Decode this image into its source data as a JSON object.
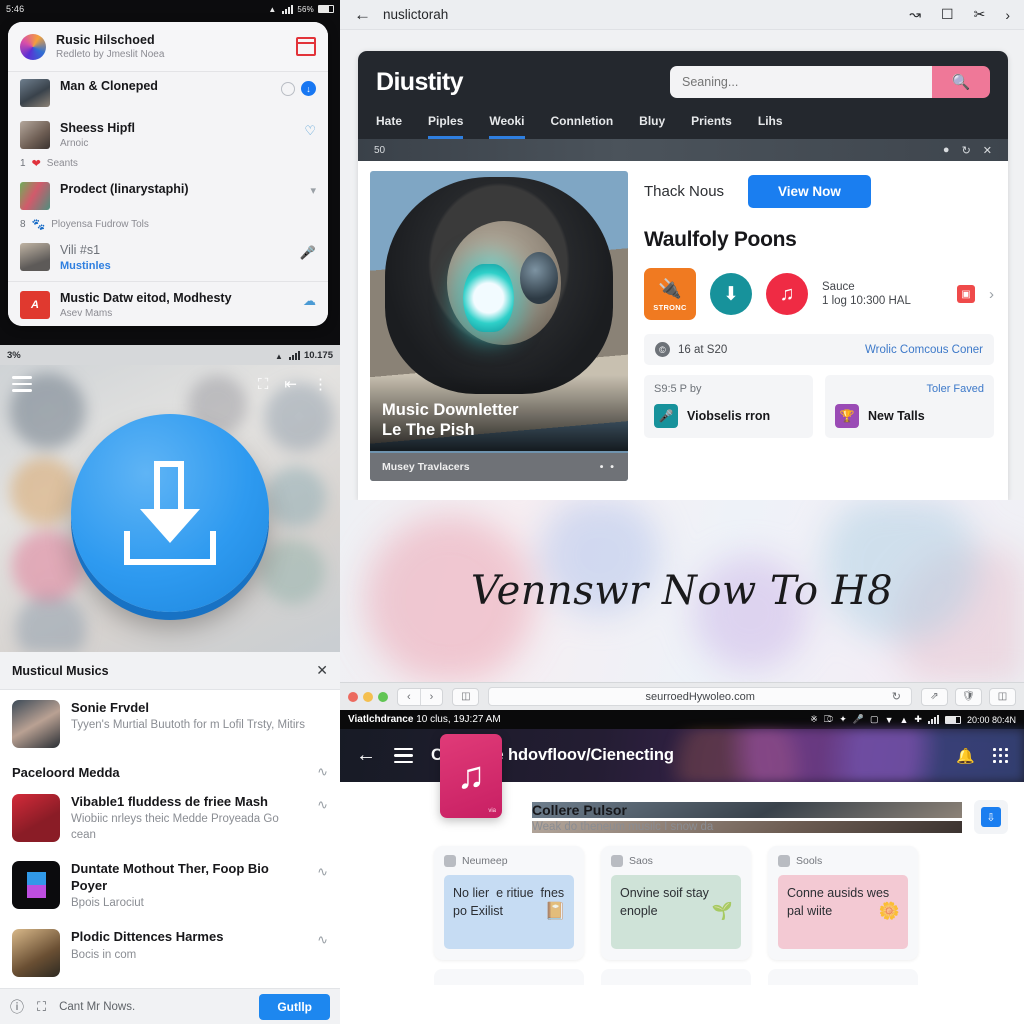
{
  "panel_a": {
    "status": {
      "time": "5:46",
      "battery": "56%"
    },
    "card": {
      "title": "Rusic Hilschoed",
      "subtitle": "Redleto by Jmeslit Noea",
      "action_icon": "inbox-icon"
    },
    "rows": [
      {
        "title": "Man & Cloneped",
        "sub": "",
        "tail": [
          "circle-icon",
          "download-badge"
        ]
      },
      {
        "title": "Sheess Hipfl",
        "sub": "Arnoic",
        "tail": [
          "heart-outline-icon"
        ]
      },
      {
        "meta_count": "1",
        "meta_icon": "heart-icon",
        "meta_text": "Seants"
      },
      {
        "title": "Prodect (linarystaphi)",
        "sub": "",
        "tail": [
          "chevron-down-icon"
        ]
      },
      {
        "meta_count": "8",
        "meta_icon": "paw-icon",
        "meta_text": "Ployensa Fudrow Tols"
      },
      {
        "title": "Vili #s1",
        "sub": "Mustinles",
        "tail": [
          "microphone-icon"
        ]
      },
      {
        "title": "Mustic Datw eitod, Modhesty",
        "sub": "Asev Mams",
        "tail": [
          "cloud-icon"
        ]
      }
    ]
  },
  "panel_b": {
    "status": {
      "left": "3%",
      "right": "10.175"
    },
    "topbar_icons": [
      "menu-icon",
      "camera-icon",
      "share-icon",
      "more-vertical-icon"
    ],
    "download_button": "download-icon",
    "sheet": {
      "title": "Musticul Musics",
      "close": "close-icon"
    },
    "items": [
      {
        "title": "Sonie Frvdel",
        "sub": "Tyyen's Murtial Buutoth for m Lofil Trsty, Mitirs"
      }
    ],
    "section": {
      "label": "Paceloord Medda",
      "chevron": "chevron-icon"
    },
    "media": [
      {
        "title": "Vibable1 fluddess de friee Mash",
        "sub": "Wiobiic nrleys theic Medde Proyeada Go cean"
      },
      {
        "title": "Duntate Mothout Ther, Foop Bio Poyer",
        "sub": "Bpois Larociut"
      },
      {
        "title": "Plodic Dittences Harmes",
        "sub": "Bocis in com"
      }
    ],
    "bottom": {
      "icons": [
        "info-icon",
        "camera-icon"
      ],
      "label": "Cant Mr Nows.",
      "button": "Gutllp"
    }
  },
  "panel_c": {
    "toolbar": {
      "back": "back-arrow-icon",
      "url": "nuslictorah",
      "actions": [
        "undo-icon",
        "save-icon",
        "cut-icon",
        "forward-icon"
      ]
    },
    "site": {
      "logo": "Diustity",
      "search": {
        "placeholder": "Seaning...",
        "button_icon": "search-icon"
      },
      "nav": [
        "Hate",
        "Piples",
        "Weoki",
        "Connletion",
        "Bluy",
        "Prients",
        "Lihs"
      ],
      "nav_active": [
        1,
        2
      ],
      "subbar": {
        "left": "50",
        "icons": [
          "location-icon",
          "refresh-icon",
          "close-icon"
        ]
      },
      "hero": {
        "caption_line1": "Music Downletter",
        "caption_line2": "Le The Pish",
        "bar_label": "Musey Travlacers",
        "bar_dots": "• •"
      },
      "content": {
        "label": "Thack Nous",
        "cta": "View Now",
        "heading": "Waulfoly Poons",
        "strong_tile": "STRONC",
        "meta1": "Sauce",
        "meta2": "1 log 10:300 HAL",
        "strip": {
          "left": "16 at S20",
          "right": "Wrolic Comcous Coner"
        },
        "tiles": [
          {
            "head": "S9:5 P by",
            "link": "",
            "title": "Viobselis rron",
            "color": "teal"
          },
          {
            "head": "",
            "link": "Toler Faved",
            "title": "New Talls",
            "color": "purple"
          }
        ]
      }
    }
  },
  "panel_d": {
    "headline": "Vennswr Now To H8"
  },
  "panel_e": {
    "traffic_lights": [
      "close",
      "minimize",
      "zoom"
    ],
    "nav_back": "‹",
    "nav_forward": "›",
    "sidebar_icon": "sidebar-icon",
    "url": "seurroedHywoleo.com",
    "reload_icon": "↻",
    "right_icons": [
      "filter-icon",
      "shield-icon",
      "window-icon"
    ]
  },
  "panel_f": {
    "status": {
      "title": "Viatlchdrance",
      "detail": "10 clus, 19J:27 AM",
      "time": "20:00 80:4N"
    },
    "header": {
      "back": "back-arrow-icon",
      "menu": "menu-icon",
      "title": "Check de hdovfloov/Cienecting",
      "right_icons": [
        "notification-off-icon",
        "apps-grid-icon"
      ]
    },
    "app": {
      "icon": "music-note-icon",
      "badge": "via",
      "title": "Collere Pulsor",
      "subtitle": "Weak do theneum musilc I snow da",
      "install_icon": "install-icon"
    },
    "cards": [
      {
        "label": "Neumeep",
        "text": "No lier  e ritiue  fnes po Exilist",
        "deco": "book-icon"
      },
      {
        "label": "Saos",
        "text": "Onvine soif stay enople",
        "deco": "plant-icon"
      },
      {
        "label": "Sools",
        "text": "Conne ausids wes pal wiite",
        "deco": "flower-icon"
      }
    ]
  }
}
